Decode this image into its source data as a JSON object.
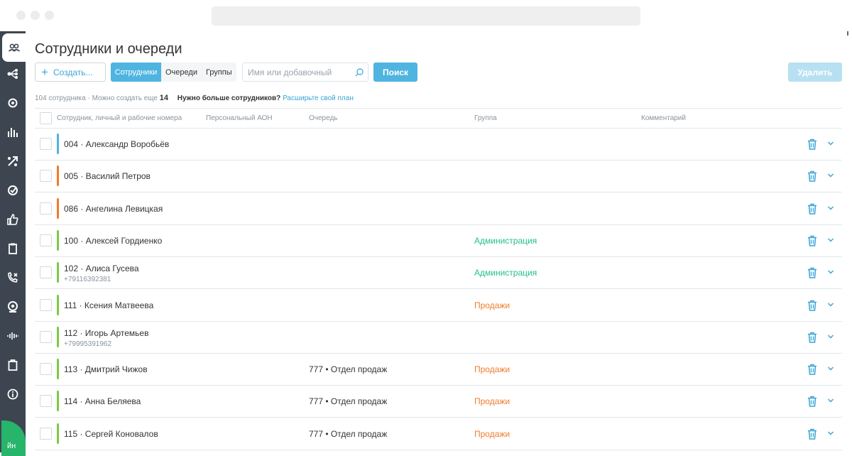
{
  "page_title": "Сотрудники и очереди",
  "toolbar": {
    "create_label": "Создать...",
    "tabs": [
      "Сотрудники",
      "Очереди",
      "Группы"
    ],
    "search_placeholder": "Имя или добавочный",
    "search_label": "Поиск",
    "delete_label": "Удалить"
  },
  "info": {
    "count_text": "104 сотрудника · Можно создать еще",
    "remaining": "14",
    "more_text": "Нужно больше сотрудников?",
    "link_text": "Расширьте свой план"
  },
  "table": {
    "headers": [
      "Сотрудник, личный и рабочие номера",
      "Персональный АОН",
      "Очередь",
      "Группа",
      "Комментарий"
    ],
    "rows": [
      {
        "name": "004 · Александр Воробьёв",
        "phone": "",
        "queue": "",
        "group": "",
        "bar_color": "#4fb4e0",
        "group_color": ""
      },
      {
        "name": "005 · Василий Петров",
        "phone": "",
        "queue": "",
        "group": "",
        "bar_color": "#f07b2a",
        "group_color": ""
      },
      {
        "name": "086 · Ангелина Левицкая",
        "phone": "",
        "queue": "",
        "group": "",
        "bar_color": "#f07b2a",
        "group_color": ""
      },
      {
        "name": "100 · Алексей Гордиенко",
        "phone": "",
        "queue": "",
        "group": "Администрация",
        "bar_color": "#7ac943",
        "group_color": "#1fbf8a"
      },
      {
        "name": "102 · Алиса Гусева",
        "phone": "+79116392381",
        "queue": "",
        "group": "Администрация",
        "bar_color": "#7ac943",
        "group_color": "#1fbf8a"
      },
      {
        "name": "111 · Ксения Матвеева",
        "phone": "",
        "queue": "",
        "group": "Продажи",
        "bar_color": "#7ac943",
        "group_color": "#f07b2a"
      },
      {
        "name": "112 · Игорь Артемьев",
        "phone": "+79995391962",
        "queue": "",
        "group": "",
        "bar_color": "#7ac943",
        "group_color": ""
      },
      {
        "name": "113 · Дмитрий Чижов",
        "phone": "",
        "queue": "777 • Отдел продаж",
        "group": "Продажи",
        "bar_color": "#7ac943",
        "group_color": "#f07b2a"
      },
      {
        "name": "114 · Анна Беляева",
        "phone": "",
        "queue": "777 • Отдел продаж",
        "group": "Продажи",
        "bar_color": "#7ac943",
        "group_color": "#f07b2a"
      },
      {
        "name": "115 · Сергей Коновалов",
        "phone": "",
        "queue": "777 • Отдел продаж",
        "group": "Продажи",
        "bar_color": "#7ac943",
        "group_color": "#f07b2a"
      }
    ]
  },
  "sidebar": {
    "icons": [
      "employees-icon",
      "routing-icon",
      "settings-icon",
      "stats-icon",
      "transfer-icon",
      "goals-icon",
      "likes-icon",
      "documents-icon",
      "missed-calls-icon",
      "webcam-icon",
      "audio-icon",
      "clipboard-icon",
      "info-icon"
    ],
    "bottom_label": "йн"
  },
  "colors": {
    "accent": "#4fb4e0",
    "sidebar": "#3d4650",
    "green": "#26b56a"
  }
}
